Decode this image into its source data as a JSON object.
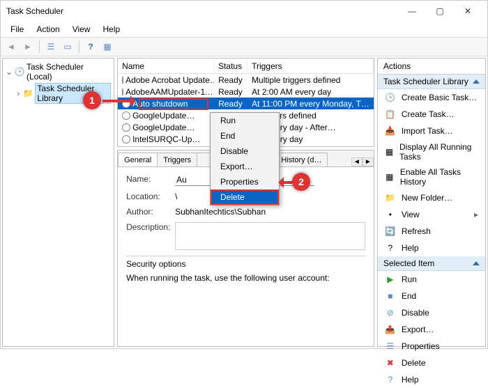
{
  "window_title": "Task Scheduler",
  "win_controls": {
    "min": "—",
    "max": "▢",
    "close": "✕"
  },
  "menubar": [
    "File",
    "Action",
    "View",
    "Help"
  ],
  "tree": {
    "root": "Task Scheduler (Local)",
    "child": "Task Scheduler Library"
  },
  "columns": {
    "name": "Name",
    "status": "Status",
    "triggers": "Triggers"
  },
  "tasks": [
    {
      "name": "Adobe Acrobat Update…",
      "status": "Ready",
      "triggers": "Multiple triggers defined"
    },
    {
      "name": "AdobeAAMUpdater-1.…",
      "status": "Ready",
      "triggers": "At 2:00 AM every day"
    },
    {
      "name": "Auto shutdown",
      "status": "Ready",
      "triggers": "At 11:00 PM every Monday, T…",
      "selected": true
    },
    {
      "name": "GoogleUpdate…",
      "status": "",
      "triggers": "e triggers defined"
    },
    {
      "name": "GoogleUpdate…",
      "status": "",
      "triggers": "PM every day - After…"
    },
    {
      "name": "IntelSURQC-Up…",
      "status": "",
      "triggers": "PM every day"
    }
  ],
  "context_items": [
    "Run",
    "End",
    "Disable",
    "Export…",
    "Properties",
    "Delete"
  ],
  "tabs": [
    "General",
    "Triggers",
    "tings",
    "History (d…"
  ],
  "details": {
    "name_label": "Name:",
    "name_val": "Au",
    "location_label": "Location:",
    "location_val": "\\",
    "author_label": "Author:",
    "author_val": "SubhanItechtics\\Subhan",
    "description_label": "Description:",
    "sec_header": "Security options",
    "sec_text": "When running the task, use the following user account:"
  },
  "actions": {
    "header": "Actions",
    "sec1": "Task Scheduler Library",
    "list1": [
      "Create Basic Task…",
      "Create Task…",
      "Import Task…",
      "Display All Running Tasks",
      "Enable All Tasks History",
      "New Folder…",
      "View",
      "Refresh",
      "Help"
    ],
    "sec2": "Selected Item",
    "list2": [
      "Run",
      "End",
      "Disable",
      "Export…",
      "Properties",
      "Delete",
      "Help"
    ]
  },
  "callouts": {
    "one": "1",
    "two": "2"
  }
}
